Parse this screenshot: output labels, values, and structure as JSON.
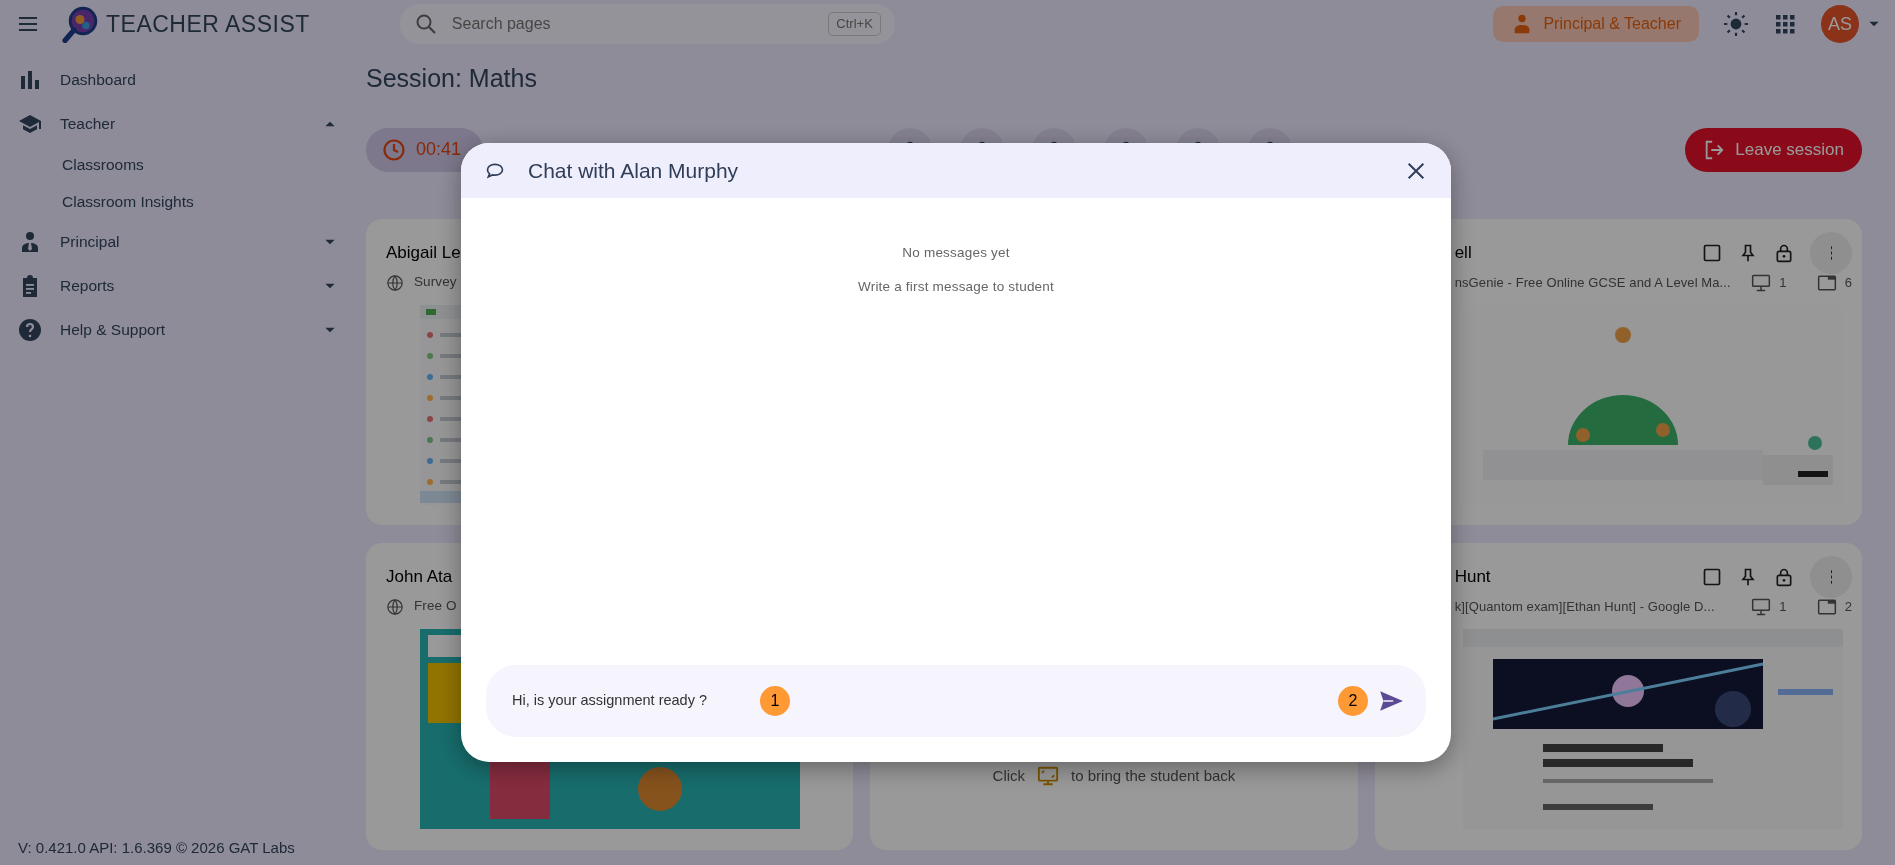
{
  "topbar": {
    "app_name": "TEACHER ASSIST",
    "search": {
      "placeholder": "Search pages",
      "shortcut": "Ctrl+K"
    },
    "role": "Principal & Teacher",
    "avatar": "AS"
  },
  "sidebar": {
    "items": [
      {
        "label": "Dashboard"
      },
      {
        "label": "Teacher",
        "expanded": true,
        "children": [
          {
            "label": "Classrooms"
          },
          {
            "label": "Classroom Insights"
          }
        ]
      },
      {
        "label": "Principal",
        "expanded": false
      },
      {
        "label": "Reports",
        "expanded": false
      },
      {
        "label": "Help & Support",
        "expanded": false
      }
    ]
  },
  "footer": {
    "text": "V: 0.421.0  API: 1.6.369  © 2026",
    "link": "GAT Labs"
  },
  "session": {
    "title": "Session: Maths",
    "timer": "00:41",
    "leave_button": "Leave session"
  },
  "cards": [
    {
      "kind": "student",
      "title": "Abigail Le",
      "subtitle": "Survey"
    },
    {
      "kind": "student",
      "title": "ell",
      "subtitle": "nsGenie - Free Online GCSE and A Level Ma...",
      "devices": "1",
      "tabs": "6"
    },
    {
      "kind": "student",
      "title": "John Ata",
      "subtitle": "Free O"
    },
    {
      "kind": "away",
      "hint_before": "Click",
      "hint_after": "to bring the student back"
    },
    {
      "kind": "student",
      "title": "Hunt",
      "subtitle": "k][Quantom exam][Ethan Hunt] - Google D...",
      "devices": "1",
      "tabs": "2"
    }
  ],
  "chat_dialog": {
    "title": "Chat with Alan Murphy",
    "empty_title": "No messages yet",
    "empty_hint": "Write a first message to student",
    "message_input": {
      "value": "Hi, is your assignment ready ?"
    },
    "markers": [
      "1",
      "2"
    ]
  }
}
